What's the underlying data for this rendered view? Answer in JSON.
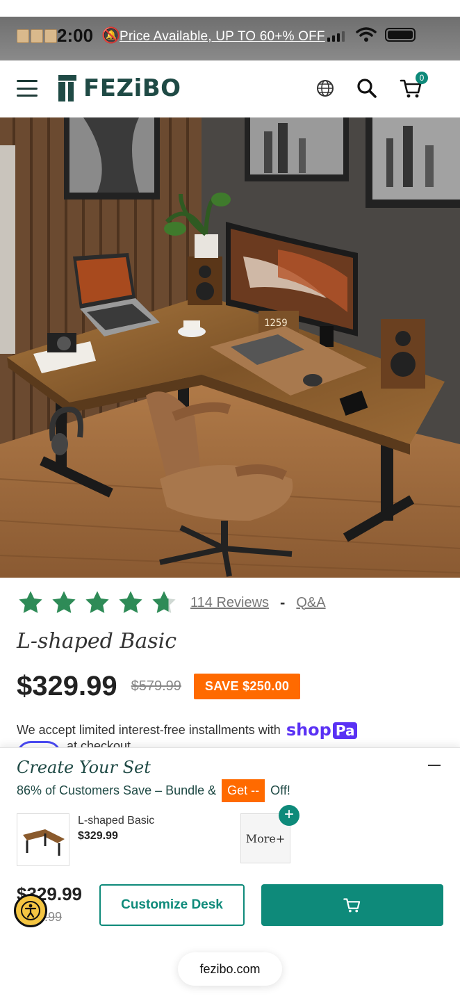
{
  "status_bar": {
    "time": "2:00",
    "promo_text": "Price Available, UP TO 60+% OFF"
  },
  "header": {
    "logo_text": "FEZiBO",
    "icons": [
      "menu-icon",
      "globe-icon",
      "search-icon",
      "cart-icon"
    ],
    "cart_count": "0"
  },
  "product": {
    "rating": 4.5,
    "reviews_label": "114 Reviews",
    "separator": "-",
    "qa_label": "Q&A",
    "title": "L-shaped Basic",
    "price": "$329.99",
    "old_price": "$579.99",
    "save_label": "SAVE $250.00",
    "installments_text": "We accept limited interest-free installments with",
    "shoppay_label": "shop",
    "shoppay_suffix": "Pa",
    "checkout_peek": "at checkout"
  },
  "bundle": {
    "title": "Create Your Set",
    "subtitle_prefix": "86% of Customers Save – Bundle &",
    "get_label": "Get --",
    "subtitle_suffix": "Off!",
    "item_name": "L-shaped Basic",
    "item_price": "$329.99",
    "more_label": "More+",
    "total_price": "$329.99",
    "total_old_price": "$579.99",
    "customize_label": "Customize Desk"
  },
  "browser": {
    "url": "fezibo.com"
  },
  "colors": {
    "brand_teal": "#0e8a7a",
    "brand_dark": "#1f4a45",
    "sale_orange": "#ff6a00",
    "star_green": "#2e8b57",
    "shoppay_purple": "#5a31f4"
  }
}
